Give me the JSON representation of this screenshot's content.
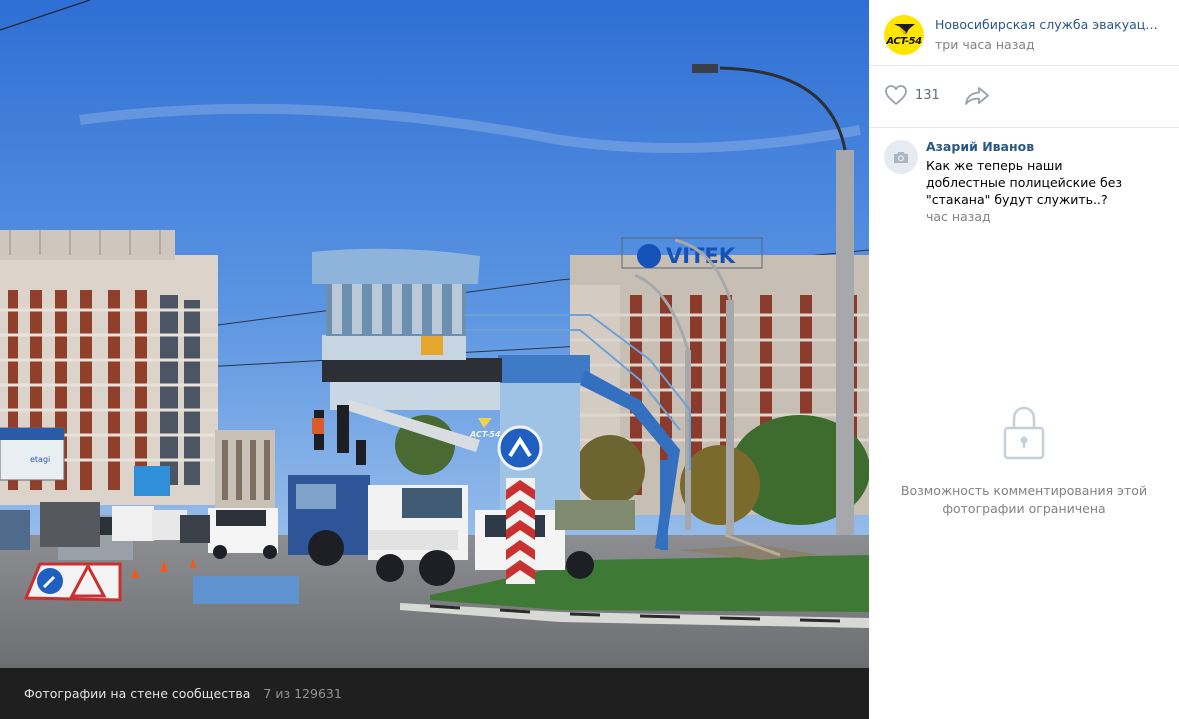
{
  "photo": {
    "description_hidden": false,
    "signage": {
      "rooftop_brand": "VITEK",
      "watermark": "ACT-54",
      "billboard_small": "etagi"
    }
  },
  "footer": {
    "album_title": "Фотографии на стене сообщества",
    "position": "7 из 129631"
  },
  "author": {
    "avatar_text": "ACT-54",
    "name": "Новосибирская служба эвакуации…",
    "time": "три часа назад"
  },
  "actions": {
    "likes": "131",
    "like_icon": "heart-icon",
    "share_icon": "share-arrow-icon"
  },
  "comments": [
    {
      "author": "Азарий Иванов",
      "text": "Как же теперь наши доблестные полицейские без \"стакана\" будут служить..?",
      "time": "час назад",
      "avatar_icon": "camera-icon"
    }
  ],
  "restriction": {
    "icon": "lock-icon",
    "text": "Возможность комментирования этой фотографии ограничена"
  },
  "colors": {
    "link": "#2a5885",
    "muted": "#828282",
    "avatar_bg": "#ffe600",
    "footer_bg": "#1f1f1f"
  }
}
